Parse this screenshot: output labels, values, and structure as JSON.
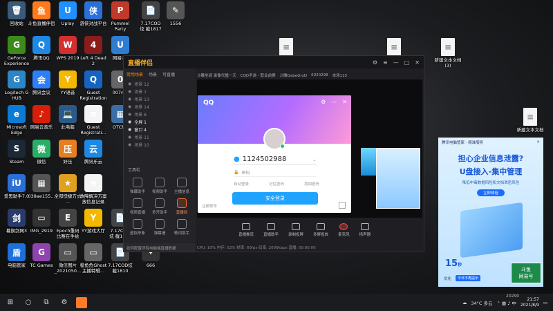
{
  "desktop": {
    "icons": [
      {
        "label": "回收站",
        "glyph": "🗑",
        "bg": "#3a5a7a",
        "col": 0,
        "row": 0
      },
      {
        "label": "斗鱼直播伴侣",
        "glyph": "鱼",
        "bg": "#ff7a1a",
        "col": 1,
        "row": 0
      },
      {
        "label": "Uplay",
        "glyph": "U",
        "bg": "#1e90ff",
        "col": 2,
        "row": 0
      },
      {
        "label": "游侠对战平台",
        "glyph": "侠",
        "bg": "#2b6fd8",
        "col": 3,
        "row": 0
      },
      {
        "label": "Pummel\nParty",
        "glyph": "P",
        "bg": "#c0392b",
        "col": 4,
        "row": 0
      },
      {
        "label": "7.17COD\n炫 截1817",
        "glyph": "📄",
        "bg": "#444",
        "col": 5,
        "row": 0
      },
      {
        "label": "1556",
        "glyph": "✎",
        "bg": "#555",
        "col": 6,
        "row": 0
      },
      {
        "label": "GeForce\nExperience",
        "glyph": "G",
        "bg": "#3b8a1a",
        "col": 0,
        "row": 1
      },
      {
        "label": "腾讯QQ",
        "glyph": "Q",
        "bg": "#1e88e5",
        "col": 1,
        "row": 1
      },
      {
        "label": "WPS 2019",
        "glyph": "W",
        "bg": "#d32f2f",
        "col": 2,
        "row": 1
      },
      {
        "label": "Left 4 Dead\n2",
        "glyph": "4",
        "bg": "#8a1c1c",
        "col": 3,
        "row": 1
      },
      {
        "label": "网易UU",
        "glyph": "U",
        "bg": "#2e7dd1",
        "col": 4,
        "row": 1
      },
      {
        "label": "Logitech G\nHUB",
        "glyph": "G",
        "bg": "#2b86c7",
        "col": 0,
        "row": 2
      },
      {
        "label": "腾讯会议",
        "glyph": "会",
        "bg": "#2d7ff9",
        "col": 1,
        "row": 2
      },
      {
        "label": "YY语音",
        "glyph": "Y",
        "bg": "#f5b800",
        "col": 2,
        "row": 2
      },
      {
        "label": "Guest\nRegistration",
        "glyph": "Q",
        "bg": "#1565c0",
        "col": 3,
        "row": 2
      },
      {
        "label": "007m5",
        "glyph": "0",
        "bg": "#666",
        "col": 4,
        "row": 2
      },
      {
        "label": "Microsoft\nEdge",
        "glyph": "e",
        "bg": "#0c7bd6",
        "col": 0,
        "row": 3
      },
      {
        "label": "网易云音乐",
        "glyph": "♪",
        "bg": "#d81e06",
        "col": 1,
        "row": 3
      },
      {
        "label": "此电脑",
        "glyph": "💻",
        "bg": "#2a5a8a",
        "col": 2,
        "row": 3
      },
      {
        "label": "Guest\nRegistrati...",
        "glyph": "≡",
        "bg": "#f4f4f4",
        "col": 3,
        "row": 3
      },
      {
        "label": "OTCNE",
        "glyph": "▦",
        "bg": "#3b6ea5",
        "col": 4,
        "row": 3
      },
      {
        "label": "Steam",
        "glyph": "S",
        "bg": "#1b2838",
        "col": 0,
        "row": 4
      },
      {
        "label": "微信",
        "glyph": "微",
        "bg": "#2aae67",
        "col": 1,
        "row": 4
      },
      {
        "label": "好压",
        "glyph": "压",
        "bg": "#e67e22",
        "col": 2,
        "row": 4
      },
      {
        "label": "腾讯乐云",
        "glyph": "云",
        "bg": "#1e88e5",
        "col": 3,
        "row": 4
      },
      {
        "label": "爱思助手7.0",
        "glyph": "iU",
        "bg": "#2a6fd6",
        "col": 0,
        "row": 5
      },
      {
        "label": "038ae155...",
        "glyph": "▦",
        "bg": "#555",
        "col": 1,
        "row": 5
      },
      {
        "label": "全部快捷方式\n...",
        "glyph": "★",
        "bg": "#e0a020",
        "col": 2,
        "row": 5
      },
      {
        "label": "故障解决方案\n放信息记录",
        "glyph": "≡",
        "bg": "#f4f4f4",
        "col": 3,
        "row": 5
      },
      {
        "label": "幕旗剑网3",
        "glyph": "剑",
        "bg": "#2a3a6a",
        "col": 0,
        "row": 6
      },
      {
        "label": "IMG_2919",
        "glyph": "▭",
        "bg": "#333",
        "col": 1,
        "row": 6
      },
      {
        "label": "Epoch重码\n比赛在手给",
        "glyph": "E",
        "bg": "#444",
        "col": 2,
        "row": 6
      },
      {
        "label": "YY游戏大厅",
        "glyph": "Y",
        "bg": "#f5b800",
        "col": 3,
        "row": 6
      },
      {
        "label": "7.17COD\n炫 截1817",
        "glyph": "📄",
        "bg": "#444",
        "col": 4,
        "row": 6
      },
      {
        "label": "电脑管家",
        "glyph": "盾",
        "bg": "#1e6fd9",
        "col": 0,
        "row": 7
      },
      {
        "label": "TC Games",
        "glyph": "G",
        "bg": "#8e44ad",
        "col": 1,
        "row": 7
      },
      {
        "label": "微信图片\n_2021050...",
        "glyph": "▭",
        "bg": "#555",
        "col": 2,
        "row": 7
      },
      {
        "label": "稳鱼危Ghost\n主播特辑...",
        "glyph": "▭",
        "bg": "#666",
        "col": 3,
        "row": 7
      },
      {
        "label": "7.17COD炫\n截1810",
        "glyph": "📄",
        "bg": "#444",
        "col": 4,
        "row": 7
      },
      {
        "label": "666",
        "glyph": "✦",
        "bg": "#333",
        "col": 5,
        "row": 7
      }
    ],
    "right_icons": [
      {
        "label": "",
        "glyph": "≡"
      },
      {
        "label": "",
        "glyph": "≡"
      },
      {
        "label": "新建文本文档\n(3)",
        "glyph": "≡"
      },
      {
        "label": "新建文本文档",
        "glyph": "≡"
      }
    ]
  },
  "app": {
    "logo": "直播伴侣",
    "tabs": [
      "常用场景",
      "场景",
      "可直播"
    ],
    "scenes": [
      "场景 12",
      "场景 1",
      "场景 13",
      "场景 14",
      "场景 8",
      "全屏 1",
      "窗口 4",
      "场景 11",
      "场景 10"
    ],
    "scene_panel_footer": "工具栏",
    "tools": [
      {
        "label": "弹幕助手",
        "hot": false
      },
      {
        "label": "视频助手",
        "hot": false
      },
      {
        "label": "主播信息",
        "hot": false
      },
      {
        "label": "视频直播",
        "hot": false
      },
      {
        "label": "多开助手",
        "hot": false
      },
      {
        "label": "直播间",
        "hot": true
      },
      {
        "label": "虚拟形象",
        "hot": false
      },
      {
        "label": "弹幕墙",
        "hot": false
      },
      {
        "label": "歌词助手",
        "hot": false
      }
    ],
    "topinfo": [
      "沙雕坐骑 录像代播一天",
      "COD手游 - 职业前赛",
      "沙雕GabeGroD",
      "6020298",
      "本场115"
    ],
    "bottom_buttons": [
      {
        "label": "直播推流",
        "red": false
      },
      {
        "label": "直播助手",
        "red": false
      },
      {
        "label": "录制投屏",
        "red": false
      },
      {
        "label": "多屏投放",
        "red": false
      },
      {
        "label": "麦克风",
        "red": true
      },
      {
        "label": "扬声器",
        "red": false
      }
    ],
    "notice": "如何配置所有电脑端直播数据",
    "status": "CPU: 10%  内存: 52%  帧率: 60fps  码率: 2000kbps  直播: 00:00:00"
  },
  "qq_login": {
    "brand": "QQ",
    "account": "1124502988",
    "password_placeholder": "密码",
    "remember_label": "自动登录",
    "remember_pwd_label": "记住密码",
    "forgot_label": "找回密码",
    "login_button": "安全登录",
    "register_label": "注册账号"
  },
  "ad": {
    "header": "腾讯电脑管家 · 精准服务",
    "line1": "担心企业信息泄露?",
    "line2": "U盘接入-集中管理",
    "line3": "降低中毒数据风险和文档泄密风险",
    "cta": "立即体验",
    "countdown": "15",
    "countdown_unit": "秒",
    "footer_text": "优化",
    "footer_button": "今日不再提示"
  },
  "watermark": {
    "line1": "斗鱼",
    "line2": "网易号"
  },
  "taskbar": {
    "weather": "34°C 多云",
    "time": "21:57",
    "date": "2021/8/9",
    "tooltip": "20290"
  }
}
